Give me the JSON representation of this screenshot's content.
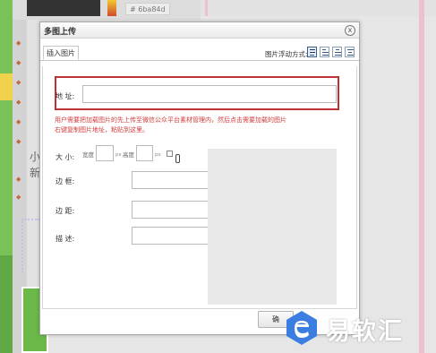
{
  "background": {
    "color_hex": "# 6ba84d",
    "chars": [
      "小",
      "新"
    ]
  },
  "dialog": {
    "title": "多图上传",
    "close_glyph": "x",
    "tab_label": "插入图片",
    "float_label": "图片浮动方式:",
    "float_options": [
      "none",
      "left",
      "right",
      "center"
    ],
    "address_label": "地 址:",
    "address_value": "",
    "notice": "用户需要把加载图片的先上传至微信公众平台素材管理内，然后点击需要加载的图片右键复制图片地址，粘贴到这里。",
    "size_label": "大 小:",
    "width_label": "宽度",
    "height_label": "高度",
    "unit": "px",
    "border_label": "边 框:",
    "margin_label": "边 距:",
    "desc_label": "描 述:",
    "confirm_label": "确"
  },
  "watermark": {
    "text": "易软汇"
  },
  "colors": {
    "notice": "#d23b3b",
    "highlight_box": "#c13030",
    "watermark_logo": "#3b7de0"
  }
}
